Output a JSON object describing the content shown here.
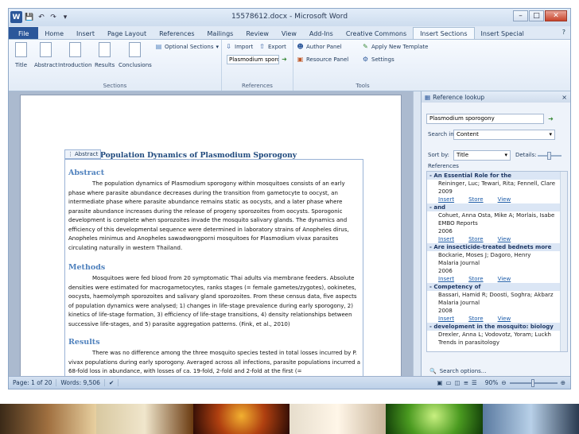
{
  "window": {
    "title": "15578612.docx - Microsoft Word"
  },
  "quick_access": {
    "logo": "W",
    "save_icon": "💾",
    "undo_icon": "↶",
    "redo_icon": "↷",
    "customize_icon": "▾"
  },
  "controls": {
    "minimize": "–",
    "maximize": "□",
    "close": "✕"
  },
  "tabs": [
    "File",
    "Home",
    "Insert",
    "Page Layout",
    "References",
    "Mailings",
    "Review",
    "View",
    "Add-Ins",
    "Creative Commons",
    "Insert Sections",
    "Insert Special"
  ],
  "active_tab": "Insert Sections",
  "help_icon": "?",
  "ribbon": {
    "sections": {
      "label": "Sections",
      "buttons": [
        "Title",
        "Abstract",
        "Introduction",
        "Results",
        "Conclusions"
      ],
      "optional": "Optional Sections"
    },
    "references": {
      "label": "References",
      "import": "Import",
      "export": "Export",
      "search_value": "Plasmodium sporo"
    },
    "tools": {
      "label": "Tools",
      "author_panel": "Author Panel",
      "resource_panel": "Resource Panel",
      "apply_template": "Apply New Template",
      "settings": "Settings"
    }
  },
  "document": {
    "abstract_tag": "Abstract",
    "title": "Population Dynamics of Plasmodium Sporogony",
    "sections": [
      {
        "heading": "Abstract",
        "text": "The population dynamics of Plasmodium sporogony within mosquitoes consists of an early phase where parasite abundance decreases during the transition from gametocyte to oocyst, an intermediate phase where parasite abundance remains static as oocysts, and a later phase where parasite abundance increases during the release of progeny sporozoites from oocysts. Sporogonic development is complete when sporozoites invade the mosquito salivary glands. The dynamics and efficiency of this developmental sequence were determined in laboratory strains of Anopheles dirus, Anopheles minimus and Anopheles sawadwongporni mosquitoes for Plasmodium vivax parasites circulating naturally in western Thailand."
      },
      {
        "heading": "Methods",
        "text": "Mosquitoes were fed blood from 20 symptomatic Thai adults via membrane feeders. Absolute densities were estimated for macrogametocytes, ranks stages (= female gametes/zygotes), ookinetes, oocysts, haemolymph sporozoites and salivary gland sporozoites. From these census data, five aspects of population dynamics were analysed; 1) changes in life-stage prevalence during early sporogony, 2) kinetics of life-stage formation, 3) efficiency of life-stage transitions, 4) density relationships between successive life-stages, and 5) parasite aggregation patterns. (Fink, et al., 2010)"
      },
      {
        "heading": "Results",
        "text": "There was no difference among the three mosquito species tested in total losses incurred by P. vivax populations during early sporogony. Averaged across all infections, parasite populations incurred a 68-fold loss in abundance, with losses of ca. 19-fold, 2-fold and 2-fold at the first (="
      }
    ]
  },
  "panel": {
    "title": "Reference lookup",
    "close": "×",
    "query": "Plasmodium sporogony",
    "search_in_label": "Search in:",
    "search_in_value": "Content",
    "sort_by_label": "Sort by:",
    "sort_by_value": "Title",
    "details_label": "Details:",
    "references_label": "References",
    "action_labels": {
      "insert": "Insert",
      "store": "Store",
      "view": "View"
    },
    "references": [
      {
        "title": "- An Essential Role for the",
        "lines": [
          "Reininger, Luc; Tewari, Rita; Fennell, Clare",
          "2009"
        ]
      },
      {
        "title": "- and",
        "lines": [
          "Cohuet, Anna Ostа, Mike A; Morlais, Isabe",
          "EMBO Reports",
          "2006"
        ]
      },
      {
        "title": "- Are insecticide-treated bednets more",
        "lines": [
          "Bockarie, Moses J; Dagoro, Henry",
          "Malaria Journal",
          "2006"
        ]
      },
      {
        "title": "- Competency of",
        "lines": [
          "Bassari, Hamid R; Doosti, Soghra; Akbarz",
          "Malaria Journal",
          "2008"
        ]
      },
      {
        "title": "- development in the mosquito: biology",
        "lines": [
          "Drexler, Anna L; Vodovotz, Yoram; Luckh",
          "Trends in parasitology"
        ]
      }
    ],
    "search_options": "Search options..."
  },
  "status": {
    "page": "Page: 1 of 20",
    "words": "Words: 9,506",
    "zoom": "90%"
  },
  "colors": {
    "accent": "#2b579a",
    "heading": "#4f81bd",
    "title": "#1f497d",
    "panel_bg": "#eef3fa"
  }
}
